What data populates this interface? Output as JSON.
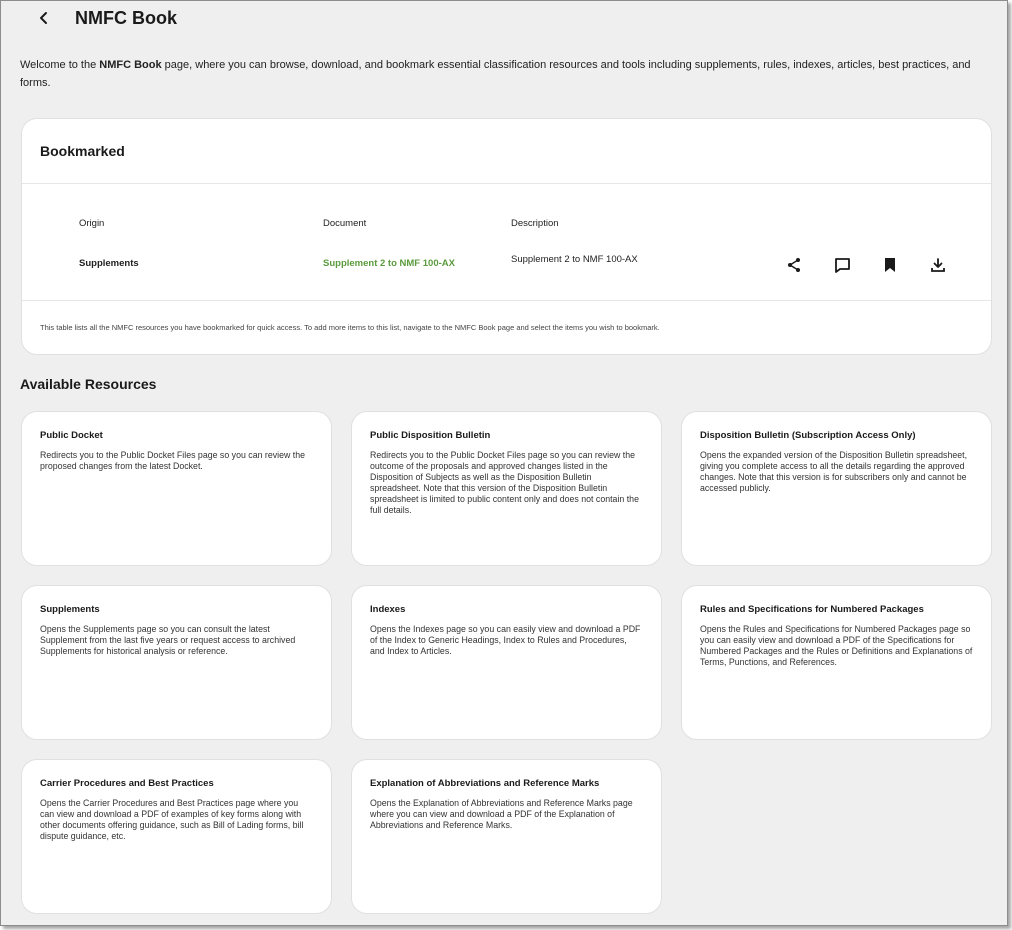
{
  "header": {
    "title": "NMFC Book",
    "back_icon": "chevron-left-icon"
  },
  "intro": {
    "prefix": "Welcome to the ",
    "bold": "NMFC Book",
    "suffix": " page, where you can browse, download, and bookmark essential classification resources and tools including supplements, rules, indexes, articles, best practices, and forms."
  },
  "bookmarked": {
    "title": "Bookmarked",
    "columns": [
      "Origin",
      "Document",
      "Description"
    ],
    "rows": [
      {
        "origin": "Supplements",
        "document": "Supplement 2 to NMF 100-AX",
        "description": "Supplement 2 to NMF 100-AX",
        "actions": [
          "share-icon",
          "comment-icon",
          "bookmark-icon",
          "download-icon"
        ]
      }
    ],
    "note": "This table lists all the NMFC resources you have bookmarked for quick access. To add more items to this list, navigate to the NMFC Book page and select the items you wish to bookmark."
  },
  "resources": {
    "title": "Available Resources",
    "items": [
      {
        "title": "Public Docket",
        "description": "Redirects you to the Public Docket Files page so you can review the proposed changes from the latest Docket."
      },
      {
        "title": "Public Disposition Bulletin",
        "description": "Redirects you to the Public Docket Files page so you can review the outcome of the proposals and approved changes listed in the Disposition of Subjects as well as the Disposition Bulletin spreadsheet. Note that this version of the Disposition Bulletin spreadsheet is limited to public content only and does not contain the full details."
      },
      {
        "title": "Disposition Bulletin (Subscription Access Only)",
        "description": "Opens the expanded version of the Disposition Bulletin spreadsheet, giving you complete access to all the details regarding the approved changes. Note that this version is for subscribers only and cannot be accessed publicly."
      },
      {
        "title": "Supplements",
        "description": "Opens the Supplements page so you can consult the latest Supplement from the last five years or request access to archived Supplements for historical analysis or reference."
      },
      {
        "title": "Indexes",
        "description": "Opens the Indexes page so you can easily view and download a PDF of the Index to Generic Headings, Index to Rules and Procedures, and Index to Articles."
      },
      {
        "title": "Rules and Specifications for Numbered Packages",
        "description": "Opens the Rules and Specifications for Numbered Packages page so you can easily view and download a PDF of the Specifications for Numbered Packages and the Rules or Definitions and Explanations of Terms, Punctions, and References."
      },
      {
        "title": "Carrier Procedures and Best Practices",
        "description": "Opens the Carrier Procedures and Best Practices page where you can view and download a PDF of examples of key forms along with other documents offering guidance, such as Bill of Lading forms, bill dispute guidance, etc."
      },
      {
        "title": "Explanation of Abbreviations and Reference Marks",
        "description": "Opens the Explanation of Abbreviations and Reference Marks page where you can view and download a PDF of the Explanation of Abbreviations and Reference Marks."
      }
    ]
  },
  "colors": {
    "background": "#efefef",
    "card": "#ffffff",
    "link_green": "#5b9b3d",
    "text": "#1a1a1a"
  }
}
